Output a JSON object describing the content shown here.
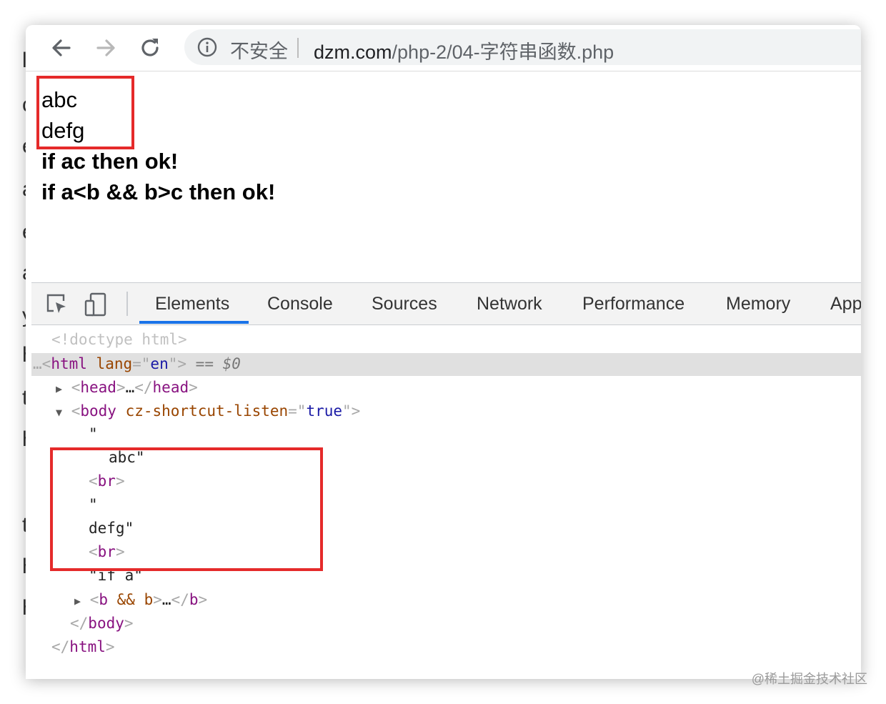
{
  "background_fragments": [
    "l",
    "c",
    "e",
    "a",
    "e",
    "a",
    "y",
    "h",
    "t",
    "h",
    "t",
    "h",
    "h"
  ],
  "address_bar": {
    "security_label": "不安全",
    "url_host": "dzm.com",
    "url_path": "/php-2/04-字符串函数.php"
  },
  "page": {
    "lines": [
      "abc",
      "defg",
      "if ac then ok!",
      "if a<b && b>c then ok!"
    ]
  },
  "devtools": {
    "tabs": [
      "Elements",
      "Console",
      "Sources",
      "Network",
      "Performance",
      "Memory",
      "App"
    ],
    "active_tab": "Elements",
    "dom": {
      "doctype": "<!doctype html>",
      "html_open_ellipsis": "…",
      "html_tag": "html",
      "html_attr_name": "lang",
      "html_attr_value": "en",
      "selected_marker": "== $0",
      "head_tag": "head",
      "head_ellipsis": "…",
      "body_tag": "body",
      "body_attr_name": "cz-shortcut-listen",
      "body_attr_value": "true",
      "text_open_1": "\"",
      "text_abc": "abc\"",
      "br_1": "br",
      "text_open_2": "\"",
      "text_defg": "defg\"",
      "br_2": "br",
      "text_if": "\"if a\"",
      "b_tag": "b",
      "b_attrs": "&& b",
      "b_ellipsis": "…",
      "body_close": "body",
      "html_close": "html"
    }
  },
  "watermark": "@稀土掘金技术社区",
  "colors": {
    "highlight_box": "#e52a2a",
    "active_tab_underline": "#1a73e8",
    "tag": "#881280",
    "attribute_name": "#994500",
    "attribute_value": "#1a1aa6"
  }
}
